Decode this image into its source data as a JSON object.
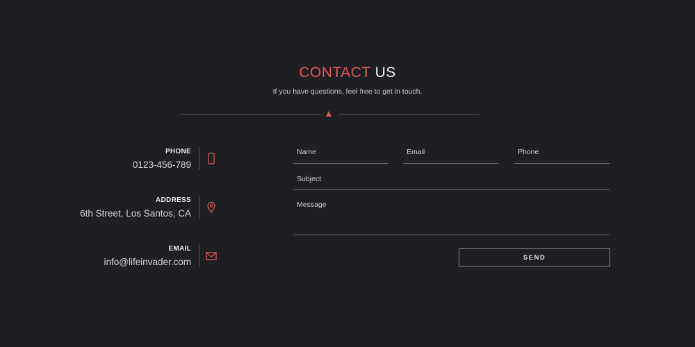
{
  "header": {
    "title_accent": "CONTACT",
    "title_rest": "US",
    "subtitle": "If you have questions, feel free to get in touch."
  },
  "contact_info": [
    {
      "label": "PHONE",
      "value": "0123-456-789",
      "icon": "phone-icon"
    },
    {
      "label": "ADDRESS",
      "value": "6th  Street, Los Santos, CA",
      "icon": "map-pin-icon"
    },
    {
      "label": "EMAIL",
      "value": "info@lifeinvader.com",
      "icon": "envelope-icon"
    }
  ],
  "form": {
    "name_placeholder": "Name",
    "email_placeholder": "Email",
    "phone_placeholder": "Phone",
    "subject_placeholder": "Subject",
    "message_placeholder": "Message",
    "send_label": "SEND"
  },
  "colors": {
    "accent": "#e05a57",
    "background": "#1e1f23"
  }
}
